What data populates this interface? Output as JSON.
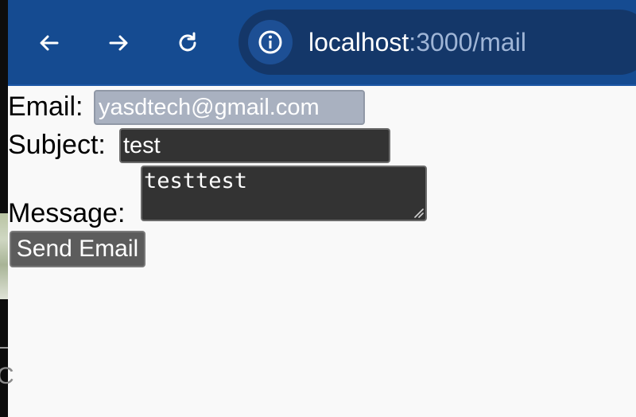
{
  "browser": {
    "back_icon": "arrow-left-icon",
    "forward_icon": "arrow-right-icon",
    "reload_icon": "reload-icon",
    "site_info_icon": "info-circle-icon",
    "url_host": "localhost",
    "url_rest": ":3000/mail",
    "colors": {
      "toolbar": "#154b91",
      "address_bar": "#143769",
      "url_host": "#ffffff",
      "url_rest": "#9fb5d6"
    }
  },
  "form": {
    "email_label": "Email:",
    "email_value": "yasdtech@gmail.com",
    "subject_label": "Subject:",
    "subject_value": "test",
    "message_label": "Message:",
    "message_value": "testtest",
    "send_label": "Send Email",
    "colors": {
      "email_bg": "#a9b1c0",
      "field_bg": "#333333",
      "button_bg": "#5c5c5c",
      "page_bg": "#f9f9f9"
    }
  },
  "left_strip": {
    "glyph": "C"
  }
}
